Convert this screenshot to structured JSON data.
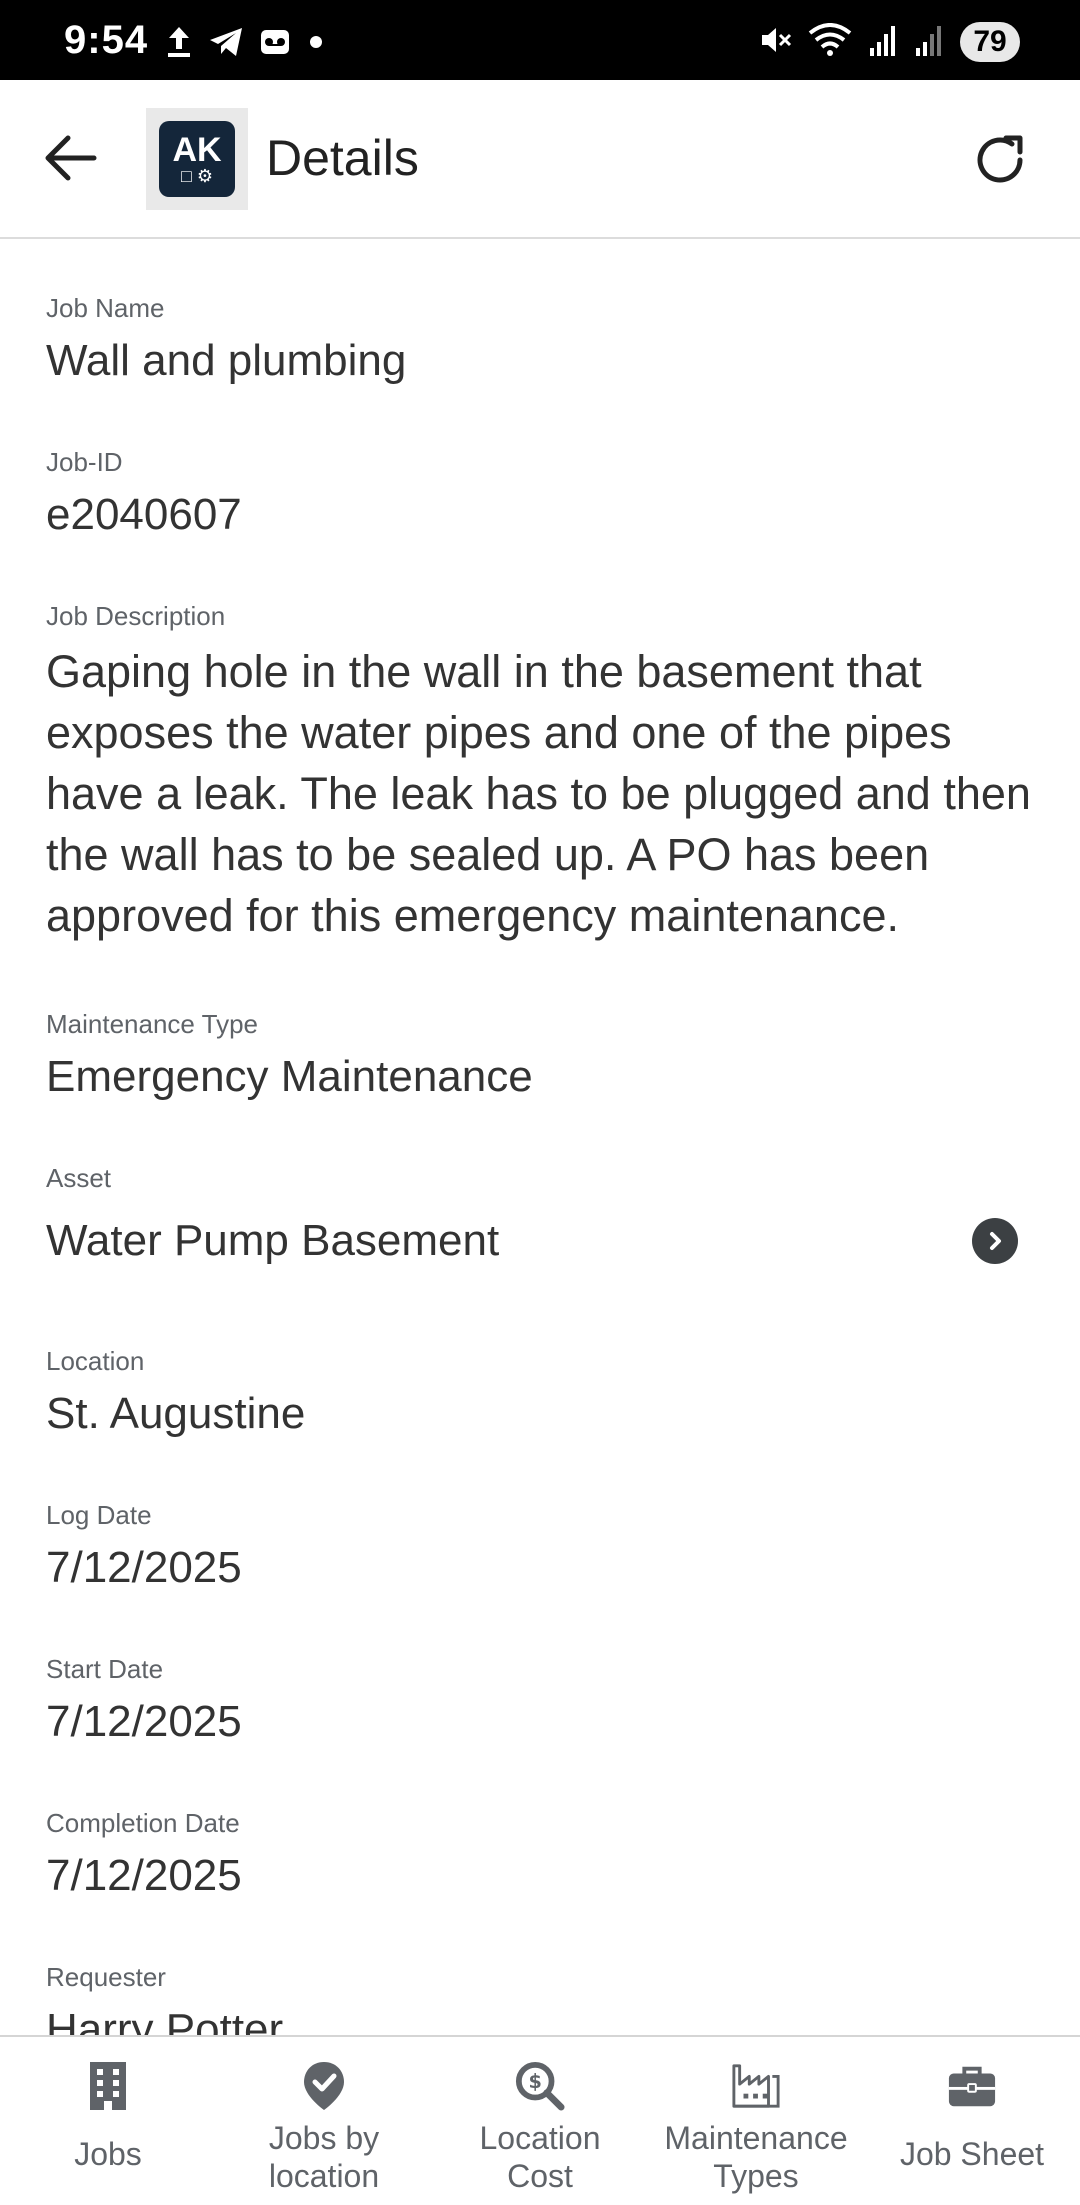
{
  "status_bar": {
    "time": "9:54",
    "battery": "79",
    "left_icons": [
      "upload-icon",
      "telegram-icon",
      "voicemail-icon",
      "dot-icon"
    ],
    "right_icons": [
      "mute-icon",
      "wifi-icon",
      "signal-icon",
      "signal-icon"
    ]
  },
  "app_bar": {
    "title": "Details",
    "logo_text": "AK",
    "back_icon": "arrow-left-icon",
    "refresh_icon": "refresh-icon"
  },
  "details": {
    "job_name_label": "Job Name",
    "job_name": "Wall and plumbing",
    "job_id_label": "Job-ID",
    "job_id": "e2040607",
    "job_description_label": "Job Description",
    "job_description": "Gaping hole in the wall in the basement that exposes the water pipes and one of the pipes have a leak.  The leak has to be plugged and then the wall has to be sealed up.  A PO has been approved for this emergency maintenance.",
    "maintenance_type_label": "Maintenance Type",
    "maintenance_type": "Emergency Maintenance",
    "asset_label": "Asset",
    "asset": "Water Pump Basement",
    "location_label": "Location",
    "location": "St. Augustine",
    "log_date_label": "Log Date",
    "log_date": "7/12/2025",
    "start_date_label": "Start Date",
    "start_date": "7/12/2025",
    "completion_date_label": "Completion Date",
    "completion_date": "7/12/2025",
    "requester_label": "Requester",
    "requester": "Harry Potter"
  },
  "bottom_nav": {
    "items": [
      {
        "label": "Jobs",
        "icon": "building-icon"
      },
      {
        "label": "Jobs by\nlocation",
        "icon": "location-check-icon"
      },
      {
        "label": "Location\nCost",
        "icon": "search-dollar-icon"
      },
      {
        "label": "Maintenance\nTypes",
        "icon": "factory-icon"
      },
      {
        "label": "Job Sheet",
        "icon": "briefcase-icon"
      }
    ]
  },
  "colors": {
    "status_bar_bg": "#000000",
    "label_gray": "#5f6368",
    "value_text": "#333333",
    "logo_bg": "#14263a"
  }
}
